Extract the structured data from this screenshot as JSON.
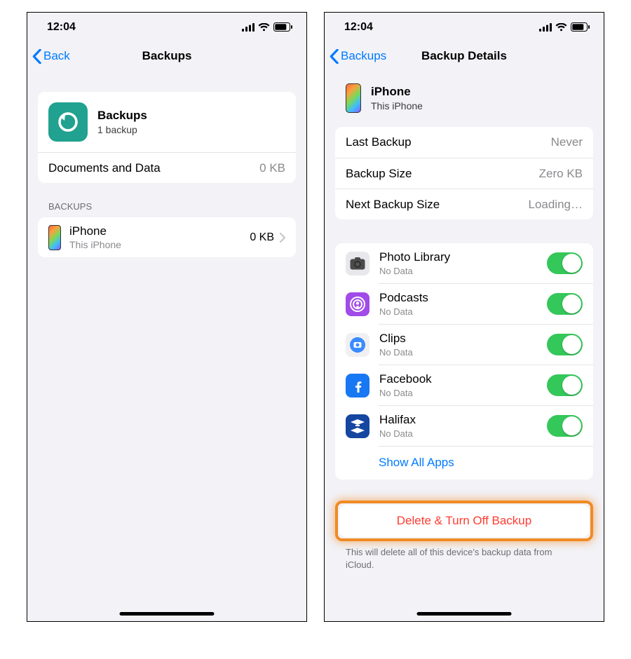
{
  "status": {
    "time": "12:04"
  },
  "left": {
    "nav": {
      "back": "Back",
      "title": "Backups"
    },
    "header": {
      "title": "Backups",
      "subtitle": "1 backup"
    },
    "docs_row": {
      "label": "Documents and Data",
      "value": "0 KB"
    },
    "section_label": "BACKUPS",
    "backup_item": {
      "title": "iPhone",
      "subtitle": "This iPhone",
      "size": "0 KB"
    }
  },
  "right": {
    "nav": {
      "back": "Backups",
      "title": "Backup Details"
    },
    "device": {
      "title": "iPhone",
      "subtitle": "This iPhone"
    },
    "info_rows": {
      "last_backup": {
        "label": "Last Backup",
        "value": "Never"
      },
      "backup_size": {
        "label": "Backup Size",
        "value": "Zero KB"
      },
      "next_backup_size": {
        "label": "Next Backup Size",
        "value": "Loading…"
      }
    },
    "apps": [
      {
        "name": "Photo Library",
        "sub": "No Data",
        "icon": "photos"
      },
      {
        "name": "Podcasts",
        "sub": "No Data",
        "icon": "podcasts"
      },
      {
        "name": "Clips",
        "sub": "No Data",
        "icon": "clips"
      },
      {
        "name": "Facebook",
        "sub": "No Data",
        "icon": "facebook"
      },
      {
        "name": "Halifax",
        "sub": "No Data",
        "icon": "halifax"
      }
    ],
    "show_all": "Show All Apps",
    "delete_button": "Delete & Turn Off Backup",
    "footer": "This will delete all of this device's backup data from iCloud."
  }
}
